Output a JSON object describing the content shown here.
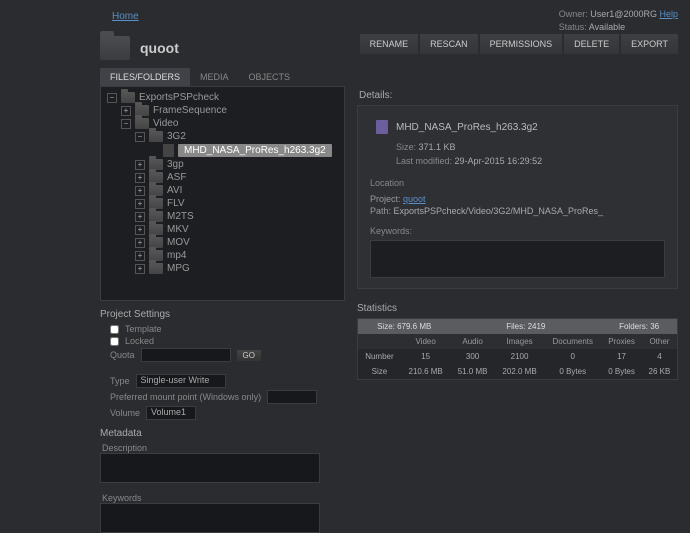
{
  "topbar": {
    "home_link": "Home",
    "owner_label": "Owner:",
    "owner_value": "User1@2000RG",
    "help_link": "Help",
    "status_label": "Status:",
    "status_value": "Available"
  },
  "header": {
    "project_name": "quoot",
    "actions": [
      "RENAME",
      "RESCAN",
      "PERMISSIONS",
      "DELETE",
      "EXPORT"
    ]
  },
  "tabs": [
    "FILES/FOLDERS",
    "MEDIA",
    "OBJECTS"
  ],
  "tree": {
    "root": "ExportsPSPcheck",
    "items": [
      {
        "label": "FrameSequence",
        "indent": 1,
        "toggle": "+"
      },
      {
        "label": "Video",
        "indent": 1,
        "toggle": "−"
      },
      {
        "label": "3G2",
        "indent": 2,
        "toggle": "−"
      },
      {
        "label": "MHD_NASA_ProRes_h263.3g2",
        "indent": 3,
        "file": true,
        "selected": true
      },
      {
        "label": "3gp",
        "indent": 2,
        "toggle": "+"
      },
      {
        "label": "ASF",
        "indent": 2,
        "toggle": "+"
      },
      {
        "label": "AVI",
        "indent": 2,
        "toggle": "+"
      },
      {
        "label": "FLV",
        "indent": 2,
        "toggle": "+"
      },
      {
        "label": "M2TS",
        "indent": 2,
        "toggle": "+"
      },
      {
        "label": "MKV",
        "indent": 2,
        "toggle": "+"
      },
      {
        "label": "MOV",
        "indent": 2,
        "toggle": "+"
      },
      {
        "label": "mp4",
        "indent": 2,
        "toggle": "+"
      },
      {
        "label": "MPG",
        "indent": 2,
        "toggle": "+"
      }
    ]
  },
  "project_settings": {
    "title": "Project Settings",
    "template_label": "Template",
    "locked_label": "Locked",
    "quota_label": "Quota",
    "go_label": "GO",
    "type_label": "Type",
    "type_value": "Single-user Write",
    "mount_label": "Preferred mount point (Windows only)",
    "volume_label": "Volume",
    "volume_value": "Volume1",
    "metadata_title": "Metadata",
    "description_label": "Description",
    "keywords_label": "Keywords"
  },
  "details": {
    "header": "Details:",
    "file_name": "MHD_NASA_ProRes_h263.3g2",
    "size_label": "Size:",
    "size_value": "371.1 KB",
    "modified_label": "Last modified:",
    "modified_value": "29-Apr-2015 16:29:52",
    "location_label": "Location",
    "project_label": "Project:",
    "project_link": "quoot",
    "path_label": "Path:",
    "path_value": "ExportsPSPcheck/Video/3G2/MHD_NASA_ProRes_",
    "keywords_label": "Keywords:"
  },
  "statistics": {
    "title": "Statistics",
    "top_headers": [
      "Size: 679.6 MB",
      "Files: 2419",
      "Folders: 36"
    ],
    "cols": [
      "",
      "Video",
      "Audio",
      "Images",
      "Documents",
      "Proxies",
      "Other"
    ],
    "rows": [
      {
        "label": "Number",
        "cells": [
          "15",
          "300",
          "2100",
          "0",
          "17",
          "4"
        ]
      },
      {
        "label": "Size",
        "cells": [
          "210.6 MB",
          "51.0 MB",
          "202.0 MB",
          "0 Bytes",
          "0 Bytes",
          "26 KB"
        ]
      }
    ]
  }
}
